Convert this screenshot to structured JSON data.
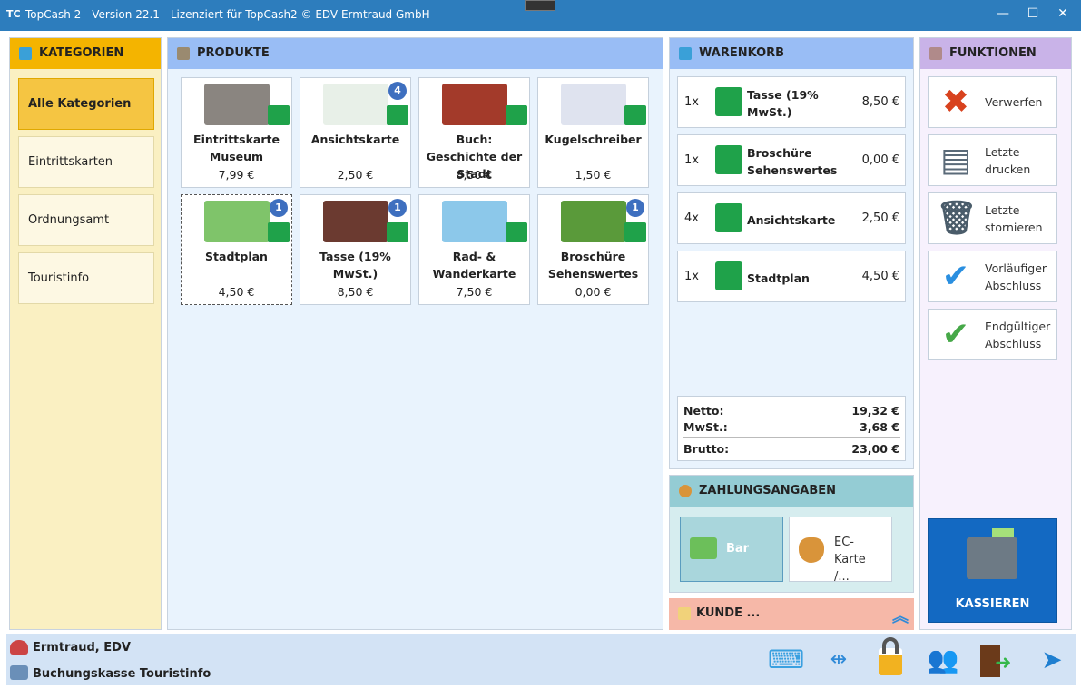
{
  "window": {
    "logo": "TC",
    "title": "TopCash 2 - Version 22.1 - Lizenziert für TopCash2  © EDV Ermtraud GmbH",
    "minimize": "—",
    "maximize": "☐",
    "close": "✕"
  },
  "kategorien": {
    "title": "KATEGORIEN",
    "items": [
      {
        "label": "Alle Kategorien",
        "selected": true
      },
      {
        "label": "Eintrittskarten"
      },
      {
        "label": "Ordnungsamt"
      },
      {
        "label": "Touristinfo"
      }
    ]
  },
  "produkte": {
    "title": "PRODUKTE",
    "items": [
      {
        "name": "Eintrittskarte Museum",
        "price": "7,99 €",
        "badge": ""
      },
      {
        "name": "Ansichtskarte",
        "price": "2,50 €",
        "badge": "4"
      },
      {
        "name": "Buch: Geschichte der Stadt",
        "price": "8,50 €",
        "badge": ""
      },
      {
        "name": "Kugelschreiber",
        "price": "1,50 €",
        "badge": ""
      },
      {
        "name": "Stadtplan",
        "price": "4,50 €",
        "badge": "1"
      },
      {
        "name": "Tasse (19% MwSt.)",
        "price": "8,50 €",
        "badge": "1"
      },
      {
        "name": "Rad- & Wanderkarte",
        "price": "7,50 €",
        "badge": ""
      },
      {
        "name": "Broschüre Sehenswertes",
        "price": "0,00 €",
        "badge": "1"
      }
    ]
  },
  "warenkorb": {
    "title": "WARENKORB",
    "items": [
      {
        "qty": "1x",
        "name": "Tasse (19% MwSt.)",
        "price": "8,50 €"
      },
      {
        "qty": "1x",
        "name": "Broschüre Sehenswertes",
        "price": "0,00 €"
      },
      {
        "qty": "4x",
        "name": "Ansichtskarte",
        "price": "2,50 €"
      },
      {
        "qty": "1x",
        "name": "Stadtplan",
        "price": "4,50 €"
      }
    ],
    "netto_label": "Netto:",
    "netto": "19,32 €",
    "mwst_label": "MwSt.:",
    "mwst": "3,68 €",
    "brutto_label": "Brutto:",
    "brutto": "23,00 €"
  },
  "zahlung": {
    "title": "ZAHLUNGSANGABEN",
    "bar": "Bar",
    "ec": "EC-Karte /..."
  },
  "kunde": {
    "title": "KUNDE ..."
  },
  "funktionen": {
    "title": "FUNKTIONEN",
    "items": [
      {
        "label": "Verwerfen"
      },
      {
        "label": "Letzte drucken"
      },
      {
        "label": "Letzte stornieren"
      },
      {
        "label": "Vorläufiger Abschluss"
      },
      {
        "label": "Endgültiger Abschluss"
      }
    ],
    "kassieren": "KASSIEREN"
  },
  "status": {
    "user": "Ermtraud, EDV",
    "kasse": "Buchungskasse Touristinfo"
  },
  "colors": {
    "titlebar": "#2d7dbd",
    "kategorien": "#f4b400",
    "produkte": "#99bdf5",
    "zahlung": "#94ccd4",
    "kunde": "#f6b8a8",
    "funktionen": "#c9b3e8",
    "kassieren": "#1369c2",
    "add": "#1fa24a"
  }
}
